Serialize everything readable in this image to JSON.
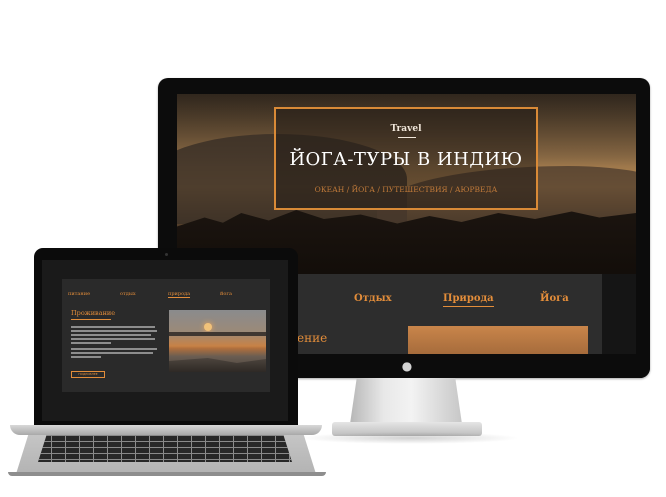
{
  "imac_site": {
    "hero": {
      "kicker": "Travel",
      "title": "ЙОГА-ТУРЫ В ИНДИЮ",
      "subtitle": "ОКЕАН / ЙОГА / ПУТЕШЕСТВИЯ / АЮРВЕДА"
    },
    "nav": {
      "items": [
        "Отдых",
        "Природа",
        "Йога"
      ],
      "active": "Природа"
    },
    "heading_fragment": "ение"
  },
  "laptop_site": {
    "nav": {
      "items": [
        "питание",
        "отдых",
        "природа",
        "йога"
      ],
      "active": "природа"
    },
    "heading": "Проживание",
    "button_label": "ПОДРОБНЕЕ"
  },
  "colors": {
    "accent": "#e38d3a",
    "frame": "#d98a37",
    "panel": "#2d2d2d"
  },
  "icons": {
    "apple": "apple-logo-icon"
  }
}
